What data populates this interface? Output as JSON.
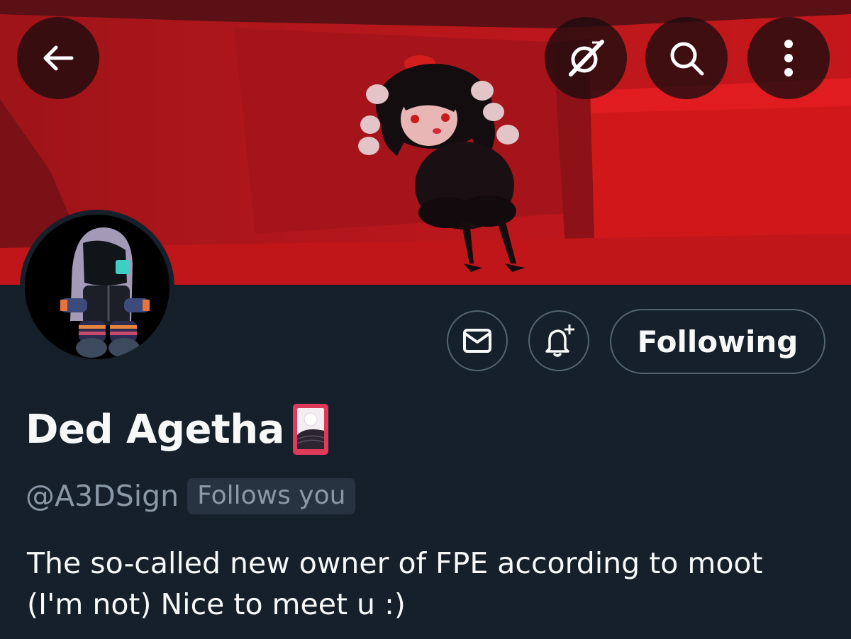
{
  "header": {
    "back_icon": "arrow-left-icon",
    "grok_icon": "grok-icon",
    "search_icon": "search-icon",
    "more_icon": "more-vertical-icon"
  },
  "profile": {
    "display_name": "Ded Agetha",
    "name_emoji": "hanafuda-card-icon",
    "handle": "@A3DSign",
    "follows_you": "Follows you",
    "bio_lines": [
      "The so-called new owner of FPE according to moot",
      "(I'm not) Nice to meet u :)"
    ]
  },
  "actions": {
    "message_icon": "envelope-icon",
    "notify_icon": "bell-plus-icon",
    "following_label": "Following"
  },
  "colors": {
    "background": "#15202b",
    "text_primary": "#f7f9f9",
    "text_secondary": "#8b98a5",
    "border": "#536471",
    "banner_red": "#c8161c"
  }
}
